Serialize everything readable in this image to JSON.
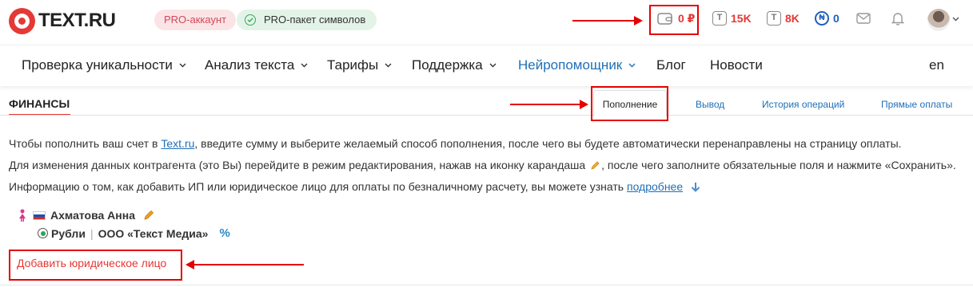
{
  "header": {
    "logo_text": "TEXT.RU",
    "badge_pro": "PRO-аккаунт",
    "badge_pack": "PRO-пакет символов",
    "balance": "0 ₽",
    "chars_pro": "15K",
    "chars_uniq": "8K",
    "coins": "0",
    "language": "en"
  },
  "nav": {
    "items": [
      {
        "label": "Проверка уникальности"
      },
      {
        "label": "Анализ текста"
      },
      {
        "label": "Тарифы"
      },
      {
        "label": "Поддержка"
      },
      {
        "label": "Нейропомощник"
      },
      {
        "label": "Блог"
      },
      {
        "label": "Новости"
      }
    ]
  },
  "finance": {
    "title": "ФИНАНСЫ",
    "tabs": [
      "Пополнение",
      "Вывод",
      "История операций",
      "Прямые оплаты"
    ]
  },
  "content": {
    "line1_pre": "Чтобы пополнить ваш счет в ",
    "line1_link": "Text.ru",
    "line1_post": ", введите сумму и выберите желаемый способ пополнения, после чего вы будете автоматически перенаправлены на страницу оплаты.",
    "line2_pre": "Для изменения данных контрагента (это Вы) перейдите в режим редактирования, нажав на иконку карандаша",
    "line2_post": ", после чего заполните обязательные поля и нажмите «Сохранить».",
    "line3_pre": "Информацию о том, как добавить ИП или юридическое лицо для оплаты по безналичному расчету, вы можете узнать ",
    "line3_link": "подробнее",
    "person_name": "Ахматова Анна",
    "currency": "Рубли",
    "separator": "|",
    "company": "ООО «Текст Медиа»",
    "percent": "%",
    "add_legal": "Добавить юридическое лицо"
  },
  "colors": {
    "brand_red": "#e53935",
    "link_blue": "#1f6fb8",
    "annotation_red": "#e50000"
  }
}
